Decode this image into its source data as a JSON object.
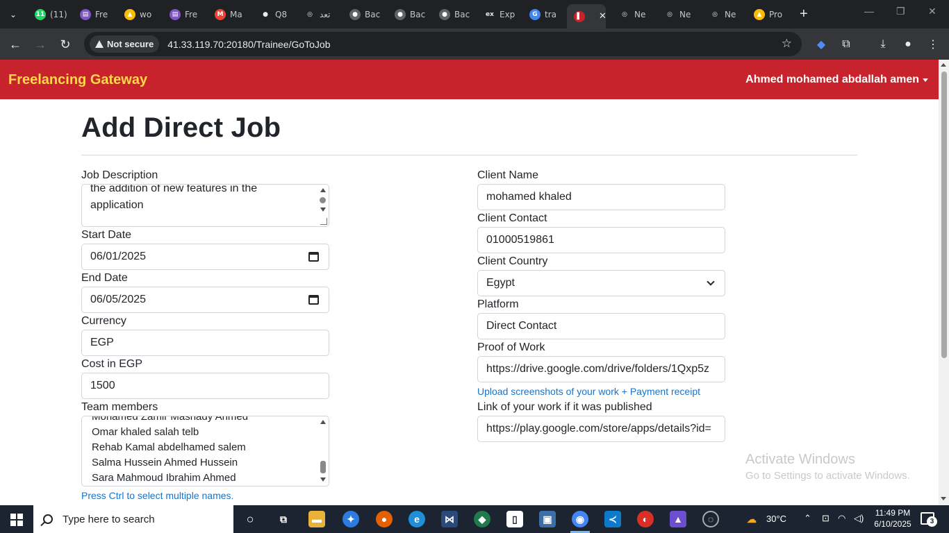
{
  "browser": {
    "tabs": [
      {
        "label": "(11)",
        "color": "#25d366",
        "glyph": "11"
      },
      {
        "label": "Fre",
        "color": "#7e57c2",
        "glyph": "▤"
      },
      {
        "label": "wo",
        "color": "#fbbc04",
        "glyph": "▲"
      },
      {
        "label": "Fre",
        "color": "#7e57c2",
        "glyph": "▤"
      },
      {
        "label": "Ma",
        "color": "#ea4335",
        "glyph": "M"
      },
      {
        "label": "Q8",
        "color": "#ffffff",
        "glyph": "●"
      },
      {
        "label": "تعد",
        "color": "#ffffff",
        "glyph": "◎"
      },
      {
        "label": "Bac",
        "color": "#5f6368",
        "glyph": "●"
      },
      {
        "label": "Bac",
        "color": "#5f6368",
        "glyph": "●"
      },
      {
        "label": "Bac",
        "color": "#5f6368",
        "glyph": "●"
      },
      {
        "label": "Exp",
        "color": "#ffffff",
        "glyph": "ex"
      },
      {
        "label": "tra",
        "color": "#4285f4",
        "glyph": "G"
      },
      {
        "label": "",
        "color": "#c8232c",
        "glyph": "▌"
      },
      {
        "label": "Ne",
        "color": "#ffffff",
        "glyph": "◎"
      },
      {
        "label": "Ne",
        "color": "#ffffff",
        "glyph": "◎"
      },
      {
        "label": "Ne",
        "color": "#ffffff",
        "glyph": "◎"
      },
      {
        "label": "Pro",
        "color": "#fbbc04",
        "glyph": "▲"
      }
    ],
    "security_label": "Not secure",
    "url": "41.33.119.70:20180/Trainee/GoToJob"
  },
  "navbar": {
    "brand": "Freelancing Gateway",
    "user": "Ahmed mohamed abdallah amen"
  },
  "page": {
    "title": "Add Direct Job"
  },
  "form": {
    "job_description": {
      "label": "Job Description",
      "value": "the addition of new features in the application"
    },
    "start_date": {
      "label": "Start Date",
      "value": "06/01/2025"
    },
    "end_date": {
      "label": "End Date",
      "value": "06/05/2025"
    },
    "currency": {
      "label": "Currency",
      "value": "EGP"
    },
    "cost": {
      "label": "Cost in EGP",
      "value": "1500"
    },
    "team_members": {
      "label": "Team members",
      "options": [
        "Mohamed Zamir Mashady Ahmed",
        "Omar khaled salah telb",
        "Rehab Kamal abdelhamed salem",
        "Salma Hussein Ahmed Hussein",
        "Sara Mahmoud Ibrahim Ahmed"
      ],
      "hint": "Press Ctrl to select multiple names."
    },
    "client_name": {
      "label": "Client Name",
      "value": "mohamed khaled"
    },
    "client_contact": {
      "label": "Client Contact",
      "value": "01000519861"
    },
    "client_country": {
      "label": "Client Country",
      "value": "Egypt"
    },
    "platform": {
      "label": "Platform",
      "value": "Direct Contact"
    },
    "proof_of_work": {
      "label": "Proof of Work",
      "value": "https://drive.google.com/drive/folders/1Qxp5z",
      "hint": "Upload screenshots of your work + Payment receipt"
    },
    "work_link": {
      "label": "Link of your work if it was published",
      "value": "https://play.google.com/store/apps/details?id="
    }
  },
  "watermark": {
    "line1": "Activate Windows",
    "line2": "Go to Settings to activate Windows."
  },
  "taskbar": {
    "search_placeholder": "Type here to search",
    "weather": "30°C",
    "time": "11:49 PM",
    "date": "6/10/2025",
    "notifications": "3"
  }
}
